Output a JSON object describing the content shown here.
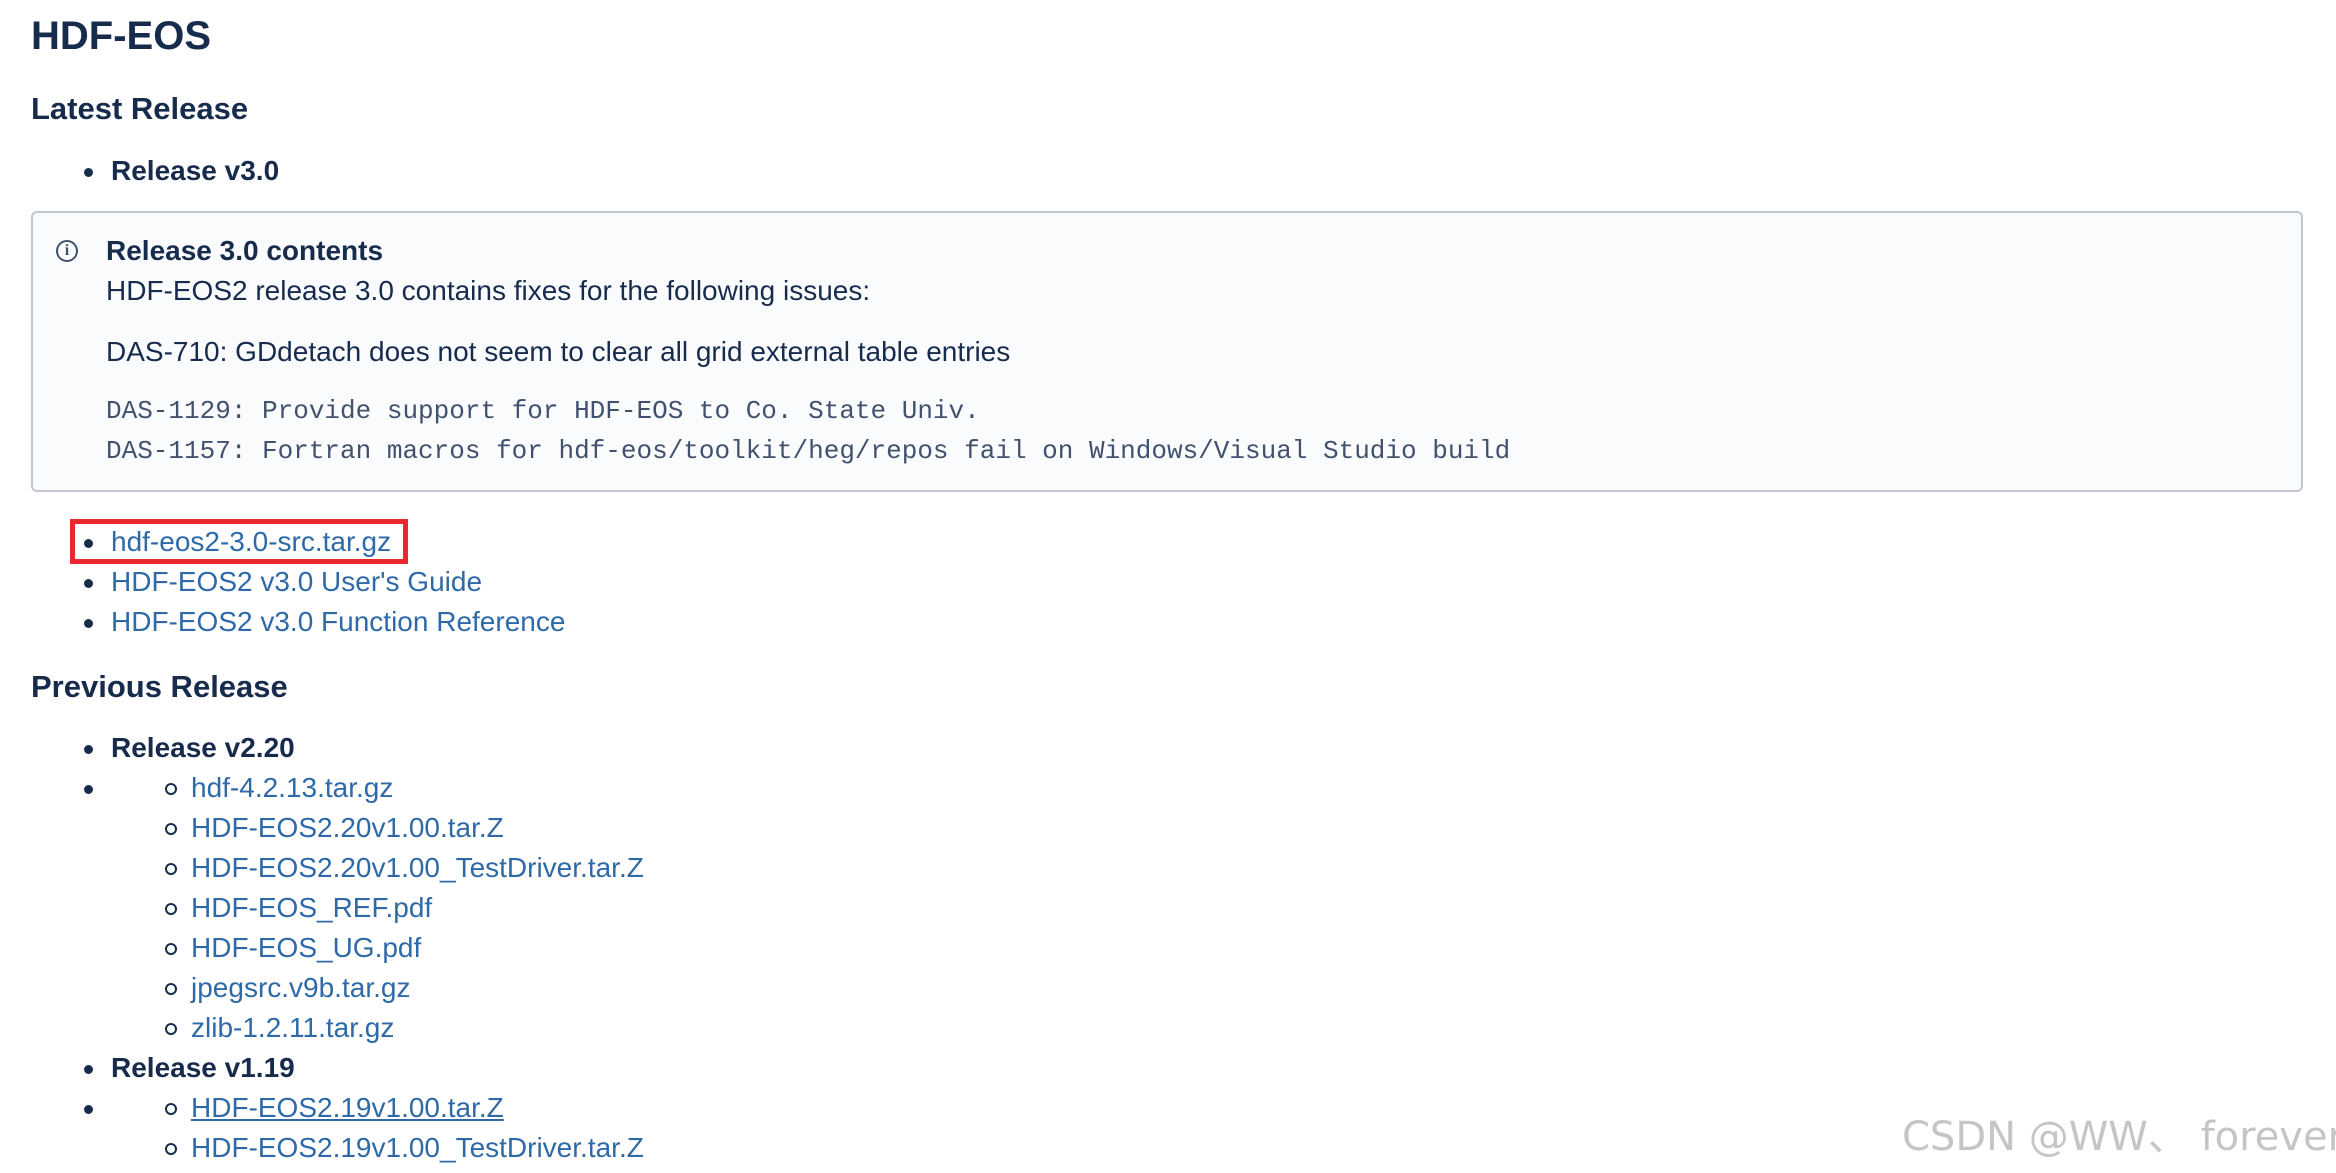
{
  "page_title": "HDF-EOS",
  "latest": {
    "heading": "Latest Release",
    "release_label": "Release v3.0",
    "info": {
      "icon": "info-icon",
      "title": "Release 3.0 contents",
      "line1": "HDF-EOS2 release 3.0 contains fixes for the following issues:",
      "line2": "DAS-710: GDdetach does not seem to clear all grid external table entries",
      "code1": "DAS-1129: Provide support for HDF-EOS to Co. State Univ.",
      "code2": "DAS-1157: Fortran macros for hdf-eos/toolkit/heg/repos fail on Windows/Visual Studio build"
    },
    "links": [
      "hdf-eos2-3.0-src.tar.gz",
      "HDF-EOS2 v3.0 User's Guide",
      "HDF-EOS2 v3.0 Function Reference"
    ]
  },
  "previous": {
    "heading": "Previous Release",
    "releases": [
      {
        "label": "Release v2.20",
        "files": [
          "hdf-4.2.13.tar.gz",
          "HDF-EOS2.20v1.00.tar.Z",
          "HDF-EOS2.20v1.00_TestDriver.tar.Z",
          "HDF-EOS_REF.pdf",
          "HDF-EOS_UG.pdf",
          "jpegsrc.v9b.tar.gz",
          "zlib-1.2.11.tar.gz"
        ]
      },
      {
        "label": "Release v1.19",
        "files": [
          "HDF-EOS2.19v1.00.tar.Z",
          "HDF-EOS2.19v1.00_TestDriver.tar.Z"
        ]
      }
    ]
  },
  "watermark": "CSDN @WW、 forever",
  "colors": {
    "link": "#2f6aa8",
    "heading": "#172b4d",
    "highlight": "#e8282d"
  }
}
